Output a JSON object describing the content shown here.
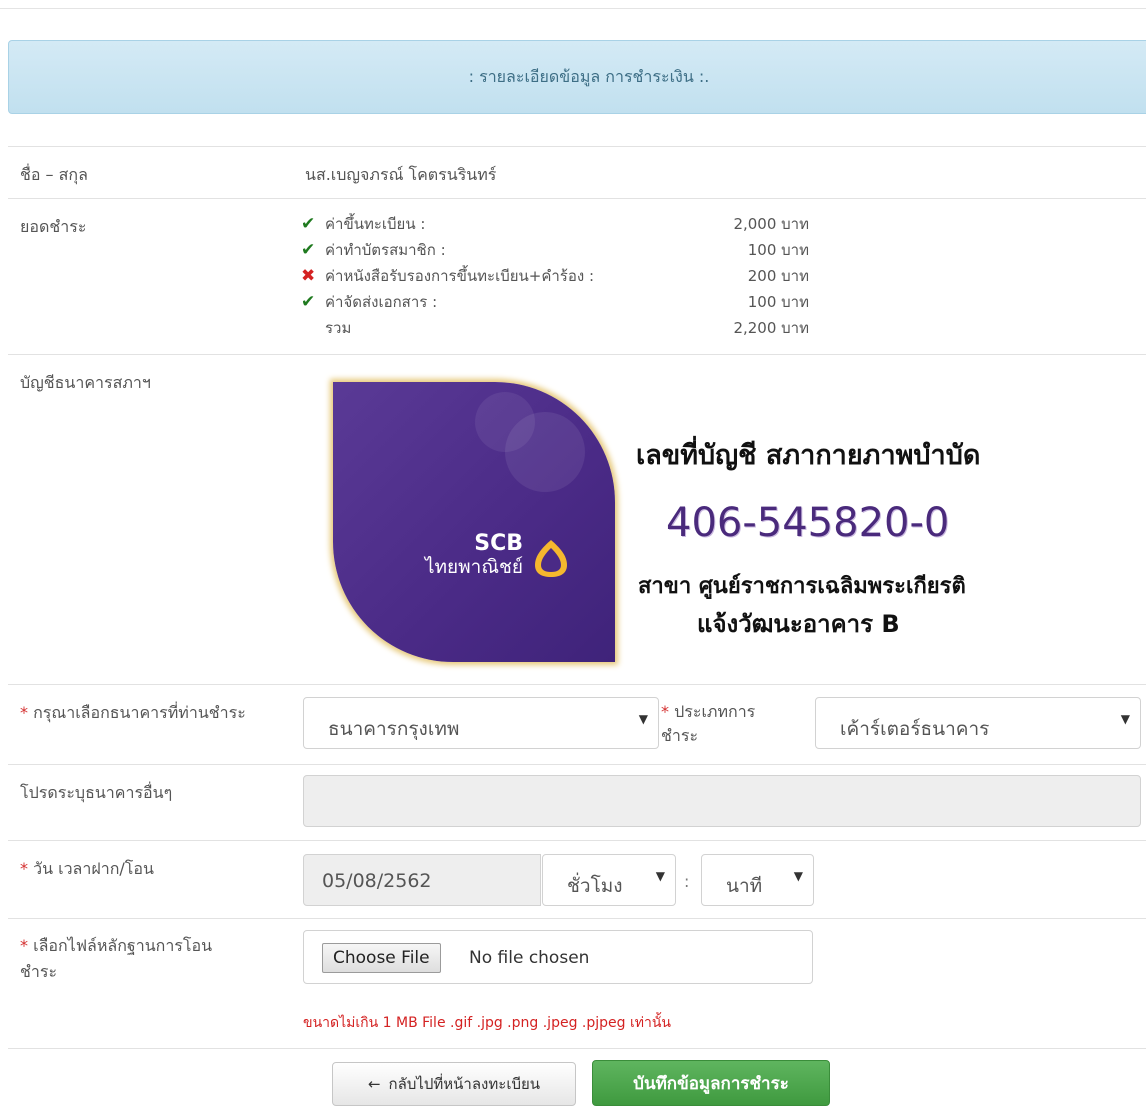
{
  "header": {
    "title": ": รายละเอียดข้อมูล การชำระเงิน :."
  },
  "name_row": {
    "label": "ชื่อ – สกุล",
    "value": "นส.เบญจภรณ์ โคตรนรินทร์"
  },
  "payment_row": {
    "label": "ยอดชำระ",
    "fees": [
      {
        "status": "checked",
        "icon": "check-icon",
        "name": "ค่าขึ้นทะเบียน :",
        "amount": "2,000 บาท"
      },
      {
        "status": "checked",
        "icon": "check-icon",
        "name": "ค่าทำบัตรสมาชิก :",
        "amount": "100 บาท"
      },
      {
        "status": "unchecked",
        "icon": "cross-icon",
        "name": "ค่าหนังสือรับรองการขึ้นทะเบียน+คำร้อง :",
        "amount": "200 บาท"
      },
      {
        "status": "checked",
        "icon": "check-icon",
        "name": "ค่าจัดส่งเอกสาร :",
        "amount": "100 บาท"
      }
    ],
    "total_label": "รวม",
    "total_amount": "2,200 บาท"
  },
  "bank_account_row": {
    "label": "บัญชีธนาคารสภาฯ",
    "bank_short": "SCB",
    "bank_thai": "ไทยพาณิชย์",
    "caption": "เลขที่บัญชี สภากายภาพบำบัด",
    "account_number": "406-545820-0",
    "branch_line1": "สาขา  ศูนย์ราชการเฉลิมพระเกียรติ",
    "branch_line2": "แจ้งวัฒนะอาคาร B",
    "colors": {
      "card": "#4a2a86",
      "number": "#4a2a7c",
      "glow": "#e7c97a"
    }
  },
  "bank_select_row": {
    "required_mark": "*",
    "label": "กรุณาเลือกธนาคารที่ท่านชำระ",
    "bank_value": "ธนาคารกรุงเทพ",
    "type_required_mark": "*",
    "type_label_1": "ประเภทการ",
    "type_label_2": "ชำระ",
    "type_value": "เค้าร์เตอร์ธนาคาร"
  },
  "other_bank_row": {
    "label": "โปรดระบุธนาคารอื่นๆ",
    "value": ""
  },
  "datetime_row": {
    "required_mark": "*",
    "label": "วัน เวลาฝาก/โอน",
    "date_value": "05/08/2562",
    "hour_value": "ชั่วโมง",
    "separator": ":",
    "minute_value": "นาที"
  },
  "file_row": {
    "required_mark": "*",
    "label_1": "เลือกไฟล์หลักฐานการโอน",
    "label_2": "ชำระ",
    "button_label": "Choose File",
    "status": "No file chosen",
    "hint": "ขนาดไม่เกิน 1 MB File .gif .jpg .png .jpeg .pjpeg เท่านั้น"
  },
  "actions": {
    "back_label": "กลับไปที่หน้าลงทะเบียน",
    "save_label": "บันทึกข้อมูลการชำระ",
    "save_color": "#4cae4c"
  }
}
